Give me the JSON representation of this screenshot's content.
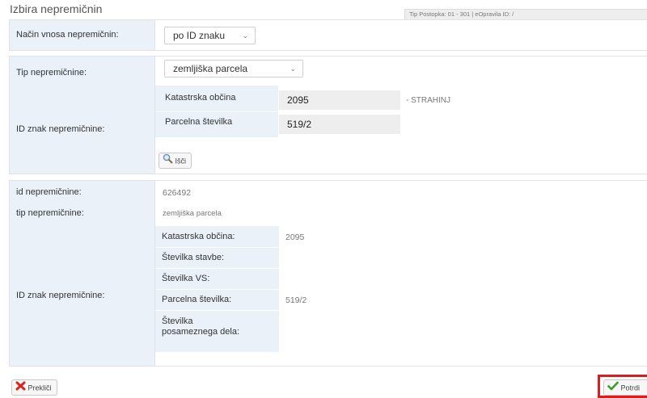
{
  "title": "Izbira nepremičnin",
  "title_info": "Tip Postopka: 01 - 301 | eOpravila ID: /",
  "method": {
    "label": "Način vnosa nepremičnin:",
    "selected": "po ID znaku"
  },
  "type_section": {
    "type_label": "Tip nepremičnine:",
    "type_selected": "zemljiška parcela",
    "id_label": "ID znak nepremičnine:",
    "ko_label": "Katastrska občina",
    "ko_value": "2095",
    "ko_name": "- STRAHINJ",
    "parcel_label": "Parcelna številka",
    "parcel_value": "519/2",
    "search_label": "Išči"
  },
  "result": {
    "id_label": "id nepremičnine:",
    "id_value": "626492",
    "type_label": "tip nepremičnine:",
    "type_value": "zemljiška parcela",
    "id_znak_label": "ID znak nepremičnine:",
    "rows": [
      {
        "label": "Katastrska občina:",
        "value": "2095"
      },
      {
        "label": "Številka stavbe:",
        "value": ""
      },
      {
        "label": "Številka VS:",
        "value": ""
      },
      {
        "label": "Parcelna številka:",
        "value": "519/2"
      },
      {
        "label": "Številka posameznega dela:",
        "value": ""
      }
    ]
  },
  "footer": {
    "cancel_label": "Prekliči",
    "confirm_label": "Potrdi"
  },
  "colors": {
    "label_bg": "#eaf1f9",
    "input_bg": "#eeeeee",
    "confirm_highlight": "#d81e1e",
    "cancel_icon": "#d9241c",
    "confirm_icon": "#3a9a2a"
  },
  "icons": {
    "search": "magnifier-icon",
    "cancel": "x-icon",
    "confirm": "checkmark-icon"
  }
}
